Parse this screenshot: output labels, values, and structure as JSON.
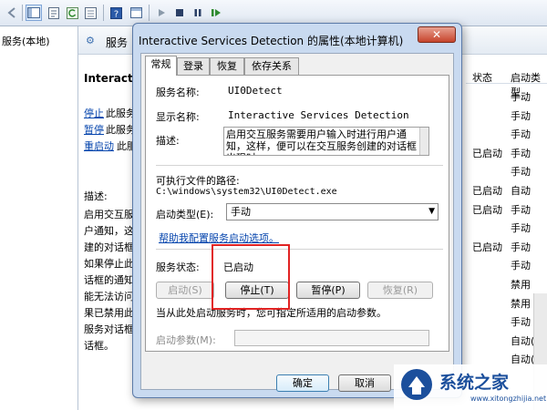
{
  "tree": {
    "root_label": "服务(本地)"
  },
  "background": {
    "header_text": "服务",
    "header_icon": "services-gear-icon",
    "service_title": "Interactive",
    "links": [
      {
        "link": "停止",
        "rest": "此服务"
      },
      {
        "link": "暂停",
        "rest": "此服务"
      },
      {
        "link": "重启动",
        "rest": "此服"
      }
    ],
    "desc_label": "描述:",
    "desc_lines": [
      "启用交互服",
      "户通知，这",
      "建的对话框",
      "如果停止此",
      "话框的通知",
      "能无法访问",
      "果已禁用此",
      "服务对话框",
      "话框。"
    ],
    "col_status": "状态",
    "col_start": "启动类型",
    "status_cells": [
      "",
      "",
      "",
      "已启动",
      "",
      "已启动",
      "已启动",
      "",
      "已启动",
      "",
      "",
      "",
      "",
      "",
      ""
    ],
    "start_cells": [
      "手动",
      "手动",
      "手动",
      "手动",
      "手动",
      "自动",
      "手动",
      "手动",
      "手动",
      "手动",
      "禁用",
      "禁用",
      "手动",
      "自动(延迟",
      "自动(延迟"
    ]
  },
  "dialog": {
    "title": "Interactive Services Detection 的属性(本地计算机)",
    "close_label": "✕",
    "tabs": [
      "常规",
      "登录",
      "恢复",
      "依存关系"
    ],
    "active_tab": 0,
    "service_name_label": "服务名称:",
    "service_name": "UI0Detect",
    "display_name_label": "显示名称:",
    "display_name": "Interactive Services Detection",
    "description_label": "描述:",
    "description": "启用交互服务需要用户输入时进行用户通知，这样，便可以在交互服务创建的对话框出现时",
    "exe_path_label": "可执行文件的路径:",
    "exe_path": "C:\\windows\\system32\\UI0Detect.exe",
    "startup_type_label": "启动类型(E):",
    "startup_type": "手动",
    "help_link": "帮助我配置服务启动选项。",
    "status_label": "服务状态:",
    "status_value": "已启动",
    "buttons": {
      "start": "启动(S)",
      "stop": "停止(T)",
      "pause": "暂停(P)",
      "resume": "恢复(R)"
    },
    "hint": "当从此处启动服务时，您可指定所适用的启动参数。",
    "params_label": "启动参数(M):",
    "params_value": "",
    "ok": "确定",
    "cancel": "取消"
  },
  "watermark": {
    "text": "系统之家",
    "url": "www.xitongzhijia.net"
  },
  "colors": {
    "highlight": "#e12323",
    "dialog_frame": "#c9daf0",
    "link": "#0645ad"
  }
}
